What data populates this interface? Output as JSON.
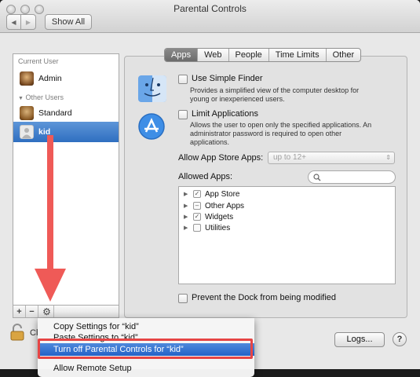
{
  "window": {
    "title": "Parental Controls"
  },
  "toolbar": {
    "show_all_label": "Show All",
    "back_glyph": "◀",
    "forward_glyph": "▶"
  },
  "sidebar": {
    "current_user_header": "Current User",
    "other_users_header": "Other Users",
    "other_users_toggle": "▼",
    "users": [
      {
        "label": "Admin"
      },
      {
        "label": "Standard"
      },
      {
        "label": "kid",
        "selected": true
      }
    ],
    "add_glyph": "+",
    "remove_glyph": "−",
    "gear_glyph": "⚙"
  },
  "tabs": [
    {
      "label": "Apps",
      "active": true
    },
    {
      "label": "Web"
    },
    {
      "label": "People"
    },
    {
      "label": "Time Limits"
    },
    {
      "label": "Other"
    }
  ],
  "apps": {
    "simple_finder": {
      "label": "Use Simple Finder",
      "checked": false,
      "description_line1": "Provides a simplified view of the computer desktop for",
      "description_line2": "young or inexperienced users."
    },
    "limit_apps": {
      "label": "Limit Applications",
      "checked": false,
      "description_line1": "Allows the user to open only the specified applications. An",
      "description_line2": "administrator password is required to open other",
      "description_line3": "applications."
    },
    "app_store_label": "Allow App Store Apps:",
    "app_store_value": "up to 12+",
    "allowed_apps_label": "Allowed Apps:",
    "allowed_apps": [
      {
        "label": "App Store",
        "state": "checked"
      },
      {
        "label": "Other Apps",
        "state": "mixed"
      },
      {
        "label": "Widgets",
        "state": "checked"
      },
      {
        "label": "Utilities",
        "state": "unchecked"
      }
    ],
    "prevent_dock": {
      "label": "Prevent the Dock from being modified",
      "checked": false
    }
  },
  "bottom": {
    "logs_label": "Logs...",
    "help_label": "?",
    "lock_text": "Cl"
  },
  "context_menu": {
    "items": [
      {
        "label": "Copy Settings for “kid”"
      },
      {
        "label": "Paste Settings to “kid”"
      },
      {
        "label": "Turn off Parental Controls for “kid”",
        "highlighted": true
      },
      {
        "label": "Allow Remote Setup"
      }
    ]
  },
  "annotation_colors": {
    "arrow": "#ef5a57",
    "highlight_box": "#e64545",
    "selection": "#2f6fc0"
  }
}
